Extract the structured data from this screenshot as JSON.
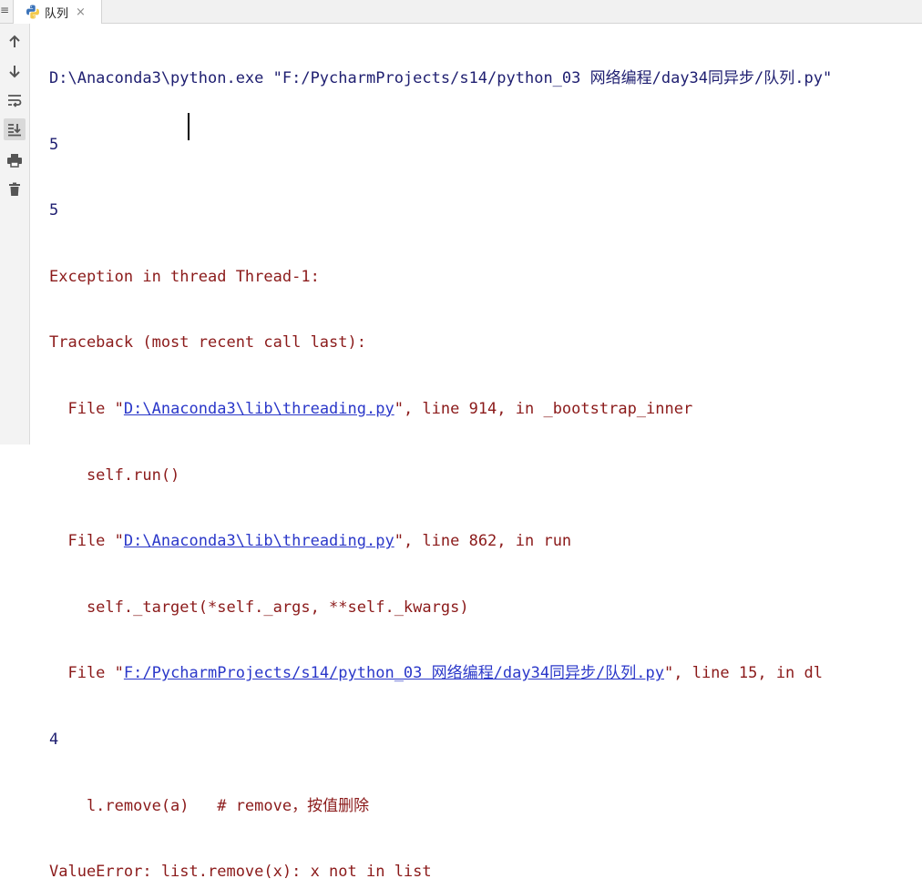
{
  "tab": {
    "left_glyph": "≡",
    "label": "队列",
    "close": "×"
  },
  "toolbar": {
    "tools": [
      {
        "name": "scroll-up-icon"
      },
      {
        "name": "scroll-down-icon"
      },
      {
        "name": "soft-wrap-icon"
      },
      {
        "name": "scroll-to-end-icon"
      },
      {
        "name": "print-icon"
      },
      {
        "name": "trash-icon"
      }
    ]
  },
  "console": {
    "l1": "D:\\Anaconda3\\python.exe \"F:/PycharmProjects/s14/python_03 网络编程/day34同异步/队列.py\"",
    "l2": "5",
    "l3": "5",
    "l4": "Exception in thread Thread-1:",
    "l5": "Traceback (most recent call last):",
    "l6_pre": "  File \"",
    "l6_link": "D:\\Anaconda3\\lib\\threading.py",
    "l6_post": "\", line 914, in _bootstrap_inner",
    "l7": "    self.run()",
    "l8_pre": "  File \"",
    "l8_link": "D:\\Anaconda3\\lib\\threading.py",
    "l8_post": "\", line 862, in run",
    "l9": "    self._target(*self._args, **self._kwargs)",
    "l10_pre": "  File \"",
    "l10_link": "F:/PycharmProjects/s14/python_03 网络编程/day34同异步/队列.py",
    "l10_post": "\", line 15, in dl",
    "l11": "4",
    "l12": "    l.remove(a)   # remove，按值删除",
    "l13": "ValueError: list.remove(x): x not in list"
  },
  "colors": {
    "stdout": "#1e1e70",
    "stderr": "#8b1a1a",
    "link": "#2a37c9"
  }
}
